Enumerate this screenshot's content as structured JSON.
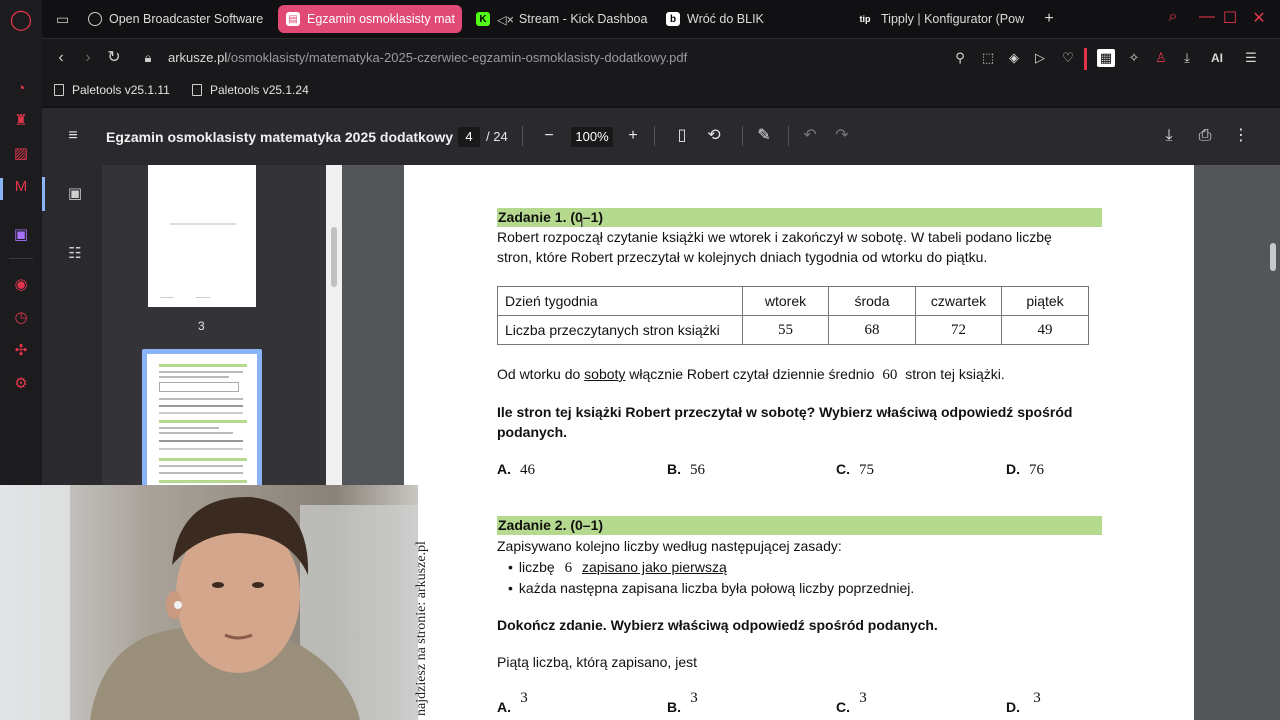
{
  "browser": {
    "tabs": [
      {
        "label": "Open Broadcaster Software",
        "active": false
      },
      {
        "label": "Egzamin osmoklasisty mat",
        "active": true
      },
      {
        "label": "Stream - Kick Dashboa",
        "active": false
      },
      {
        "label": "Wróć do BLIK",
        "active": false
      },
      {
        "label": "Tipply | Konfigurator (Pow",
        "active": false
      }
    ],
    "url_host": "arkusze.pl",
    "url_path": "/osmoklasisty/matematyka-2025-czerwiec-egzamin-osmoklasisty-dodatkowy.pdf",
    "bookmarks": [
      "Paletools v25.1.11",
      "Paletools v25.1.24"
    ],
    "ai_label": "AI"
  },
  "pdf_viewer": {
    "title": "Egzamin osmoklasisty matematyka 2025 dodatkowy",
    "current_page": "4",
    "page_total": "/ 24",
    "zoom": "100%",
    "thumb_label": "3"
  },
  "task1": {
    "heading": "Zadanie 1. (0–1)",
    "intro_line1": "Robert rozpoczął czytanie książki we wtorek i zakończył w sobotę. W tabeli podano liczbę",
    "intro_line2": "stron, które Robert przeczytał w kolejnych dniach tygodnia od wtorku do piątku.",
    "table": {
      "header_row": [
        "Dzień tygodnia",
        "wtorek",
        "środa",
        "czwartek",
        "piątek"
      ],
      "data_row": [
        "Liczba przeczytanych stron książki",
        "55",
        "68",
        "72",
        "49"
      ]
    },
    "avg_before": "Od wtorku do",
    "avg_underlined": "soboty",
    "avg_middle": "włącznie Robert czytał dziennie średnio",
    "avg_number": "60",
    "avg_after": "stron tej książki.",
    "question_line1": "Ile stron tej książki Robert przeczytał w sobotę? Wybierz właściwą odpowiedź spośród",
    "question_line2": "podanych.",
    "answers": [
      {
        "letter": "A.",
        "value": "46"
      },
      {
        "letter": "B.",
        "value": "56"
      },
      {
        "letter": "C.",
        "value": "75"
      },
      {
        "letter": "D.",
        "value": "76"
      }
    ]
  },
  "task2": {
    "heading": "Zadanie 2. (0–1)",
    "intro": "Zapisywano kolejno liczby według następującej zasady:",
    "bullet1_before": "liczbę",
    "bullet1_number": "6",
    "bullet1_underlined": "zapisano jako pierwszą",
    "bullet2": "każda następna zapisana liczba była połową liczby poprzedniej.",
    "instruction": "Dokończ zdanie. Wybierz właściwą odpowiedź spośród podanych.",
    "sentence": "Piątą liczbą, którą zapisano, jest",
    "answers": [
      {
        "letter": "A.",
        "numerator": "3"
      },
      {
        "letter": "B.",
        "numerator": "3"
      },
      {
        "letter": "C.",
        "numerator": "3"
      },
      {
        "letter": "D.",
        "numerator": "3"
      }
    ]
  },
  "watermark": "najdziesz na stronie: arkusze.pl",
  "colors": {
    "opera_red": "#e0364b",
    "active_tab": "#e04a75",
    "task_header_bg": "#b5d98f",
    "pdf_toolbar": "#2a2a2e",
    "pdf_canvas": "#525659"
  }
}
